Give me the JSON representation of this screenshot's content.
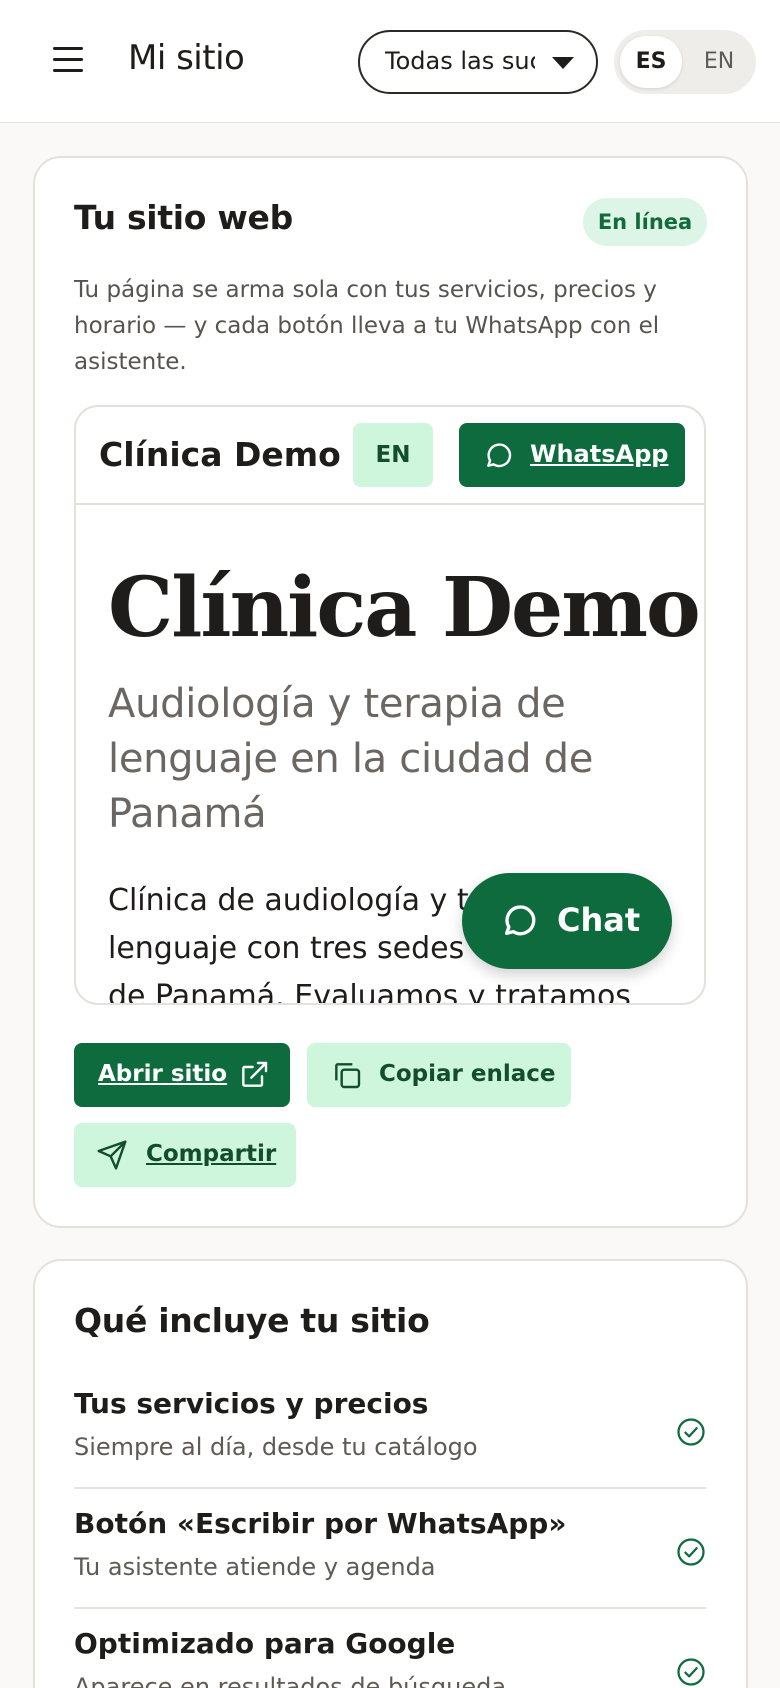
{
  "header": {
    "brand": "Mi sitio",
    "branch_select": "Todas las sucursales",
    "lang_es": "ES",
    "lang_en": "EN"
  },
  "website_card": {
    "title": "Tu sitio web",
    "status": "En línea",
    "description": "Tu página se arma sola con tus servicios, precios y horario — y cada botón lleva a tu WhatsApp con el asistente.",
    "preview": {
      "site_name": "Clínica Demo",
      "lang_button": "EN",
      "whatsapp_button": "WhatsApp",
      "hero_title": "Clínica Demo",
      "hero_subtitle": "Audiología y terapia de lenguaje en la ciudad de Panamá",
      "hero_body": "Clínica de audiología y terapia de lenguaje con tres sedes en la ciudad de Panamá. Evaluamos y tratamos"
    },
    "chat_button": "Chat",
    "open_button": "Abrir sitio",
    "copy_button": "Copiar enlace",
    "share_button": "Compartir"
  },
  "includes_card": {
    "title": "Qué incluye tu sitio",
    "items": [
      {
        "title": "Tus servicios y precios",
        "desc": "Siempre al día, desde tu catálogo"
      },
      {
        "title": "Botón «Escribir por WhatsApp»",
        "desc": "Tu asistente atiende y agenda"
      },
      {
        "title": "Optimizado para Google",
        "desc": "Aparece en resultados de búsqueda"
      }
    ]
  },
  "colors": {
    "accent": "#0e6b3e",
    "accent_light": "#cdf6dc",
    "badge_bg": "#dcf5e6",
    "background": "#faf9f7"
  },
  "icons": [
    "menu-icon",
    "chevron-down-icon",
    "whatsapp-icon",
    "chat-bubble-icon",
    "external-link-icon",
    "copy-icon",
    "send-icon",
    "check-circle-icon"
  ]
}
